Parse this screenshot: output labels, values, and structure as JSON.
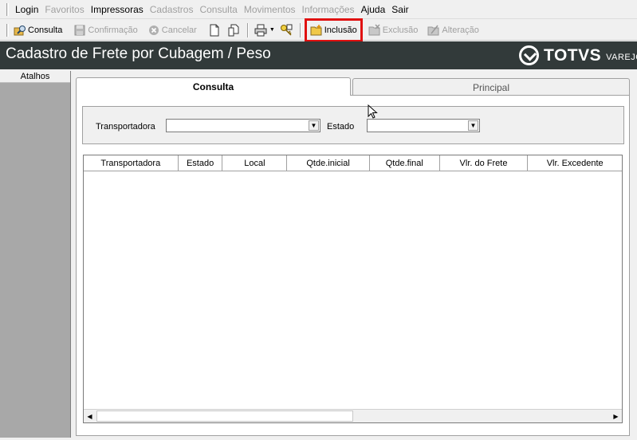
{
  "menu": {
    "items": [
      {
        "label": "Login",
        "enabled": true
      },
      {
        "label": "Favoritos",
        "enabled": false
      },
      {
        "label": "Impressoras",
        "enabled": true
      },
      {
        "label": "Cadastros",
        "enabled": false
      },
      {
        "label": "Consulta",
        "enabled": false
      },
      {
        "label": "Movimentos",
        "enabled": false
      },
      {
        "label": "Informações",
        "enabled": false
      },
      {
        "label": "Ajuda",
        "enabled": true
      },
      {
        "label": "Sair",
        "enabled": true
      }
    ]
  },
  "toolbar": {
    "consulta": "Consulta",
    "confirmacao": "Confirmação",
    "cancelar": "Cancelar",
    "inclusao": "Inclusão",
    "exclusao": "Exclusão",
    "alteracao": "Alteração"
  },
  "header": {
    "title": "Cadastro de Frete por Cubagem / Peso",
    "brand": "TOTVS",
    "brand_sub": "VAREJO"
  },
  "sidebar": {
    "title": "Atalhos"
  },
  "tabs": [
    {
      "label": "Consulta",
      "active": true
    },
    {
      "label": "Principal",
      "active": false
    }
  ],
  "filter": {
    "transportadora_label": "Transportadora",
    "transportadora_value": "",
    "estado_label": "Estado",
    "estado_value": ""
  },
  "grid": {
    "columns": [
      "Transportadora",
      "Estado",
      "Local",
      "Qtde.inicial",
      "Qtde.final",
      "Vlr. do Frete",
      "Vlr. Excedente"
    ],
    "rows": []
  },
  "colors": {
    "title_bg": "#323a3a",
    "highlight": "#e01010"
  }
}
